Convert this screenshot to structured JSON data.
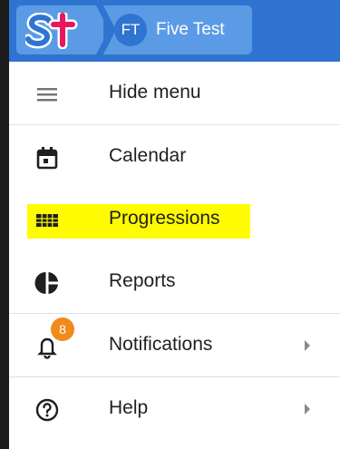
{
  "header": {
    "logo_text": "st",
    "user_initials": "FT",
    "user_name": "Five Test"
  },
  "menu": {
    "items": [
      {
        "label": "Hide menu",
        "icon": "hamburger-icon"
      },
      {
        "label": "Calendar",
        "icon": "calendar-icon"
      },
      {
        "label": "Progressions",
        "icon": "grid-icon",
        "highlighted": true
      },
      {
        "label": "Reports",
        "icon": "pie-chart-icon"
      },
      {
        "label": "Notifications",
        "icon": "bell-icon",
        "badge": "8",
        "has_submenu": true
      },
      {
        "label": "Help",
        "icon": "help-circle-icon",
        "has_submenu": true
      }
    ]
  },
  "colors": {
    "header": "#2f74d1",
    "chip": "#5b9be6",
    "logo_s": "#2f74d1",
    "logo_t": "#e8175d",
    "highlight": "#fffb00",
    "badge": "#f08a1c"
  }
}
